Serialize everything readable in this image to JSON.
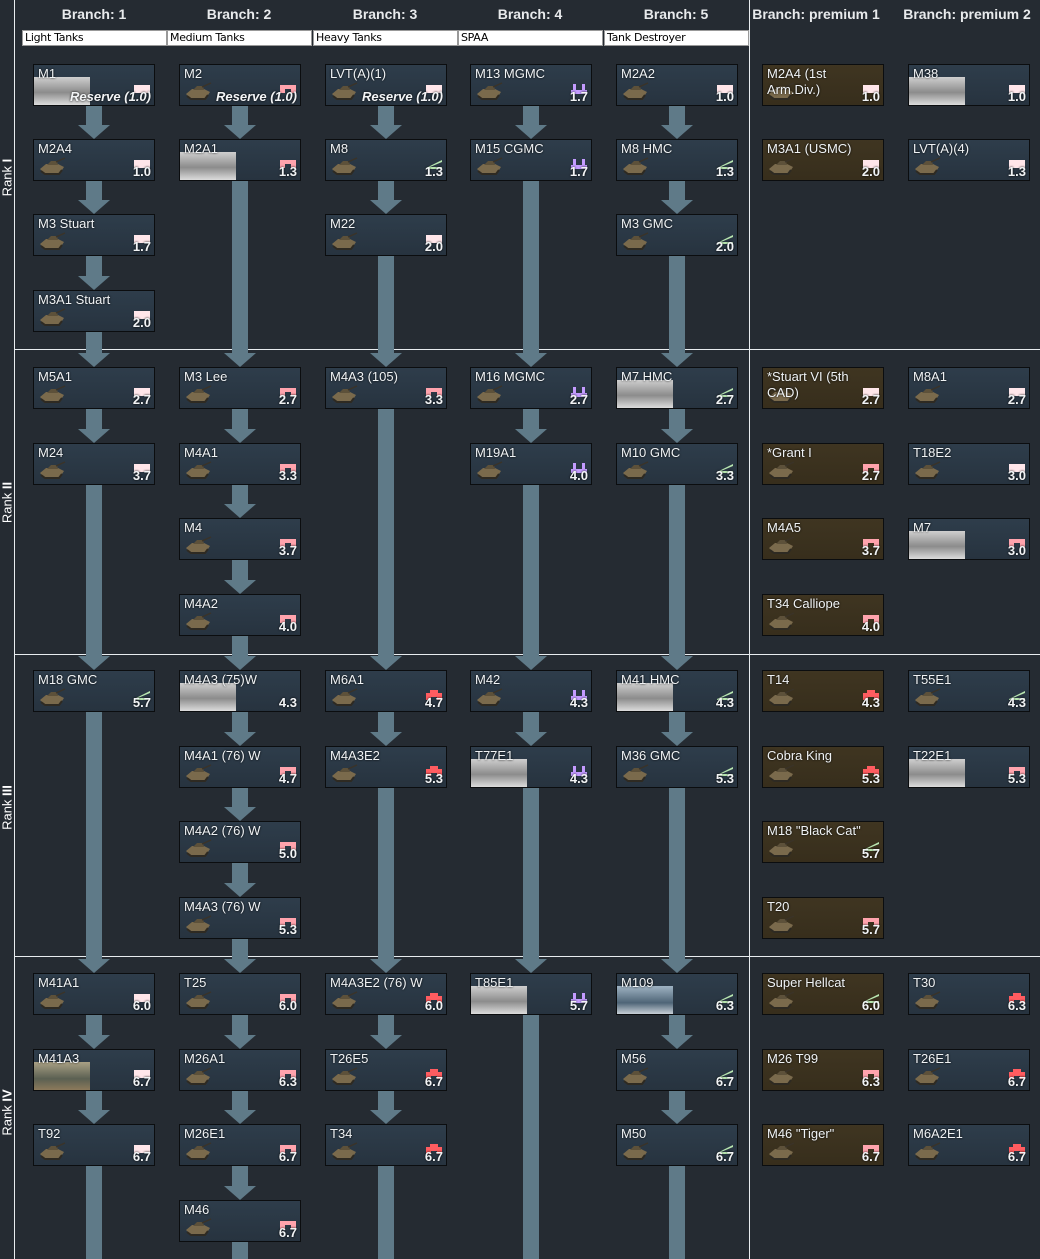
{
  "colors": {
    "light": "#ffe6ea",
    "medium": "#ffa3ad",
    "heavy": "#ff5c60",
    "spaa": "#c39bff",
    "td": "#b8e6b0"
  },
  "ranks": [
    {
      "prefix": "Rank",
      "numeral": "I"
    },
    {
      "prefix": "Rank",
      "numeral": "II"
    },
    {
      "prefix": "Rank",
      "numeral": "III"
    },
    {
      "prefix": "Rank",
      "numeral": "IV"
    }
  ],
  "branches": [
    {
      "header": "Branch: 1",
      "filter": "Light Tanks"
    },
    {
      "header": "Branch: 2",
      "filter": "Medium Tanks"
    },
    {
      "header": "Branch: 3",
      "filter": "Heavy Tanks"
    },
    {
      "header": "Branch: 4",
      "filter": "SPAA"
    },
    {
      "header": "Branch: 5",
      "filter": "Tank Destroyer"
    },
    {
      "header": "Branch: premium 1",
      "filter": null
    },
    {
      "header": "Branch: premium 2",
      "filter": null
    }
  ],
  "vehicles": [
    {
      "col": 0,
      "row": 0,
      "name": "M1",
      "cls": "light",
      "br": "Reserve (1.0)",
      "reserve": true,
      "photo": "bw"
    },
    {
      "col": 0,
      "row": 1,
      "name": "M2A4",
      "cls": "light",
      "br": "1.0"
    },
    {
      "col": 0,
      "row": 2,
      "name": "M3 Stuart",
      "cls": "light",
      "br": "1.7"
    },
    {
      "col": 0,
      "row": 3,
      "name": "M3A1 Stuart",
      "cls": "light",
      "br": "2.0"
    },
    {
      "col": 0,
      "row": 4,
      "name": "M5A1",
      "cls": "light",
      "br": "2.7"
    },
    {
      "col": 0,
      "row": 5,
      "name": "M24",
      "cls": "light",
      "br": "3.7"
    },
    {
      "col": 0,
      "row": 8,
      "name": "M18 GMC",
      "cls": "td",
      "br": "5.7"
    },
    {
      "col": 0,
      "row": 12,
      "name": "M41A1",
      "cls": "light",
      "br": "6.0"
    },
    {
      "col": 0,
      "row": 13,
      "name": "M41A3",
      "cls": "light",
      "br": "6.7",
      "photo": "color"
    },
    {
      "col": 0,
      "row": 14,
      "name": "T92",
      "cls": "light",
      "br": "6.7"
    },
    {
      "col": 1,
      "row": 0,
      "name": "M2",
      "cls": "medium",
      "br": "Reserve (1.0)",
      "reserve": true
    },
    {
      "col": 1,
      "row": 1,
      "name": "M2A1",
      "cls": "medium",
      "br": "1.3",
      "photo": "bw"
    },
    {
      "col": 1,
      "row": 4,
      "name": "M3 Lee",
      "cls": "medium",
      "br": "2.7"
    },
    {
      "col": 1,
      "row": 5,
      "name": "M4A1",
      "cls": "medium",
      "br": "3.3"
    },
    {
      "col": 1,
      "row": 6,
      "name": "M4",
      "cls": "medium",
      "br": "3.7"
    },
    {
      "col": 1,
      "row": 7,
      "name": "M4A2",
      "cls": "medium",
      "br": "4.0"
    },
    {
      "col": 1,
      "row": 8,
      "name": "M4A3 (75)W",
      "cls": null,
      "br": "4.3",
      "photo": "bw"
    },
    {
      "col": 1,
      "row": 9,
      "name": "M4A1 (76) W",
      "cls": "medium",
      "br": "4.7"
    },
    {
      "col": 1,
      "row": 10,
      "name": "M4A2 (76) W",
      "cls": "medium",
      "br": "5.0"
    },
    {
      "col": 1,
      "row": 11,
      "name": "M4A3 (76) W",
      "cls": "medium",
      "br": "5.3"
    },
    {
      "col": 1,
      "row": 12,
      "name": "T25",
      "cls": "medium",
      "br": "6.0"
    },
    {
      "col": 1,
      "row": 13,
      "name": "M26A1",
      "cls": "medium",
      "br": "6.3"
    },
    {
      "col": 1,
      "row": 14,
      "name": "M26E1",
      "cls": "medium",
      "br": "6.7"
    },
    {
      "col": 1,
      "row": 15,
      "name": "M46",
      "cls": "medium",
      "br": "6.7"
    },
    {
      "col": 2,
      "row": 0,
      "name": "LVT(A)(1)",
      "cls": "light",
      "br": "Reserve (1.0)",
      "reserve": true
    },
    {
      "col": 2,
      "row": 1,
      "name": "M8",
      "cls": "td",
      "br": "1.3"
    },
    {
      "col": 2,
      "row": 2,
      "name": "M22",
      "cls": "light",
      "br": "2.0"
    },
    {
      "col": 2,
      "row": 4,
      "name": "M4A3 (105)",
      "cls": "medium",
      "br": "3.3"
    },
    {
      "col": 2,
      "row": 8,
      "name": "M6A1",
      "cls": "heavy",
      "br": "4.7"
    },
    {
      "col": 2,
      "row": 9,
      "name": "M4A3E2",
      "cls": "heavy",
      "br": "5.3"
    },
    {
      "col": 2,
      "row": 12,
      "name": "M4A3E2 (76) W",
      "cls": "heavy",
      "br": "6.0"
    },
    {
      "col": 2,
      "row": 13,
      "name": "T26E5",
      "cls": "heavy",
      "br": "6.7"
    },
    {
      "col": 2,
      "row": 14,
      "name": "T34",
      "cls": "heavy",
      "br": "6.7"
    },
    {
      "col": 3,
      "row": 0,
      "name": "M13 MGMC",
      "cls": "spaa",
      "br": "1.7"
    },
    {
      "col": 3,
      "row": 1,
      "name": "M15 CGMC",
      "cls": "spaa",
      "br": "1.7"
    },
    {
      "col": 3,
      "row": 4,
      "name": "M16 MGMC",
      "cls": "spaa",
      "br": "2.7"
    },
    {
      "col": 3,
      "row": 5,
      "name": "M19A1",
      "cls": "spaa",
      "br": "4.0"
    },
    {
      "col": 3,
      "row": 8,
      "name": "M42",
      "cls": "spaa",
      "br": "4.3"
    },
    {
      "col": 3,
      "row": 9,
      "name": "T77E1",
      "cls": "spaa",
      "br": "4.3",
      "photo": "bw"
    },
    {
      "col": 3,
      "row": 12,
      "name": "T85E1",
      "cls": "spaa",
      "br": "5.7",
      "photo": "bw"
    },
    {
      "col": 4,
      "row": 0,
      "name": "M2A2",
      "cls": "light",
      "br": "1.0"
    },
    {
      "col": 4,
      "row": 1,
      "name": "M8 HMC",
      "cls": "td",
      "br": "1.3"
    },
    {
      "col": 4,
      "row": 2,
      "name": "M3 GMC",
      "cls": "td",
      "br": "2.0"
    },
    {
      "col": 4,
      "row": 4,
      "name": "M7 HMC",
      "cls": "td",
      "br": "2.7",
      "photo": "bw"
    },
    {
      "col": 4,
      "row": 5,
      "name": "M10 GMC",
      "cls": "td",
      "br": "3.3"
    },
    {
      "col": 4,
      "row": 8,
      "name": "M41 HMC",
      "cls": "td",
      "br": "4.3",
      "photo": "bw"
    },
    {
      "col": 4,
      "row": 9,
      "name": "M36 GMC",
      "cls": "td",
      "br": "5.3"
    },
    {
      "col": 4,
      "row": 12,
      "name": "M109",
      "cls": "td",
      "br": "6.3",
      "photo": "blue"
    },
    {
      "col": 4,
      "row": 13,
      "name": "M56",
      "cls": "td",
      "br": "6.7"
    },
    {
      "col": 4,
      "row": 14,
      "name": "M50",
      "cls": "td",
      "br": "6.7"
    },
    {
      "col": 5,
      "row": 0,
      "name": "M2A4 (1st Arm.Div.)",
      "cls": "light",
      "br": "1.0",
      "premium": true
    },
    {
      "col": 5,
      "row": 1,
      "name": "M3A1 (USMC)",
      "cls": "light",
      "br": "2.0",
      "premium": true
    },
    {
      "col": 5,
      "row": 4,
      "name": "*Stuart VI (5th CAD)",
      "cls": "light",
      "br": "2.7",
      "premium": true
    },
    {
      "col": 5,
      "row": 5,
      "name": "*Grant I",
      "cls": "medium",
      "br": "2.7",
      "premium": true
    },
    {
      "col": 5,
      "row": 6,
      "name": "M4A5",
      "cls": "medium",
      "br": "3.7",
      "premium": true
    },
    {
      "col": 5,
      "row": 7,
      "name": "T34 Calliope",
      "cls": "medium",
      "br": "4.0",
      "premium": true
    },
    {
      "col": 5,
      "row": 8,
      "name": "T14",
      "cls": "heavy",
      "br": "4.3",
      "premium": true
    },
    {
      "col": 5,
      "row": 9,
      "name": "Cobra King",
      "cls": "heavy",
      "br": "5.3",
      "premium": true
    },
    {
      "col": 5,
      "row": 10,
      "name": "M18 \"Black Cat\"",
      "cls": "td",
      "br": "5.7",
      "premium": true
    },
    {
      "col": 5,
      "row": 11,
      "name": "T20",
      "cls": "medium",
      "br": "5.7",
      "premium": true
    },
    {
      "col": 5,
      "row": 12,
      "name": "Super Hellcat",
      "cls": "td",
      "br": "6.0",
      "premium": true
    },
    {
      "col": 5,
      "row": 13,
      "name": "M26 T99",
      "cls": "medium",
      "br": "6.3",
      "premium": true
    },
    {
      "col": 5,
      "row": 14,
      "name": "M46 \"Tiger\"",
      "cls": "medium",
      "br": "6.7",
      "premium": true
    },
    {
      "col": 6,
      "row": 0,
      "name": "M38",
      "cls": "light",
      "br": "1.0",
      "photo": "bw"
    },
    {
      "col": 6,
      "row": 1,
      "name": "LVT(A)(4)",
      "cls": "light",
      "br": "1.3"
    },
    {
      "col": 6,
      "row": 4,
      "name": "M8A1",
      "cls": "light",
      "br": "2.7"
    },
    {
      "col": 6,
      "row": 5,
      "name": "T18E2",
      "cls": "light",
      "br": "3.0"
    },
    {
      "col": 6,
      "row": 6,
      "name": "M7",
      "cls": "medium",
      "br": "3.0",
      "photo": "bw"
    },
    {
      "col": 6,
      "row": 8,
      "name": "T55E1",
      "cls": "td",
      "br": "4.3"
    },
    {
      "col": 6,
      "row": 9,
      "name": "T22E1",
      "cls": "medium",
      "br": "5.3",
      "photo": "bw"
    },
    {
      "col": 6,
      "row": 12,
      "name": "T30",
      "cls": "heavy",
      "br": "6.3"
    },
    {
      "col": 6,
      "row": 13,
      "name": "T26E1",
      "cls": "heavy",
      "br": "6.7"
    },
    {
      "col": 6,
      "row": 14,
      "name": "M6A2E1",
      "cls": "heavy",
      "br": "6.7"
    }
  ]
}
